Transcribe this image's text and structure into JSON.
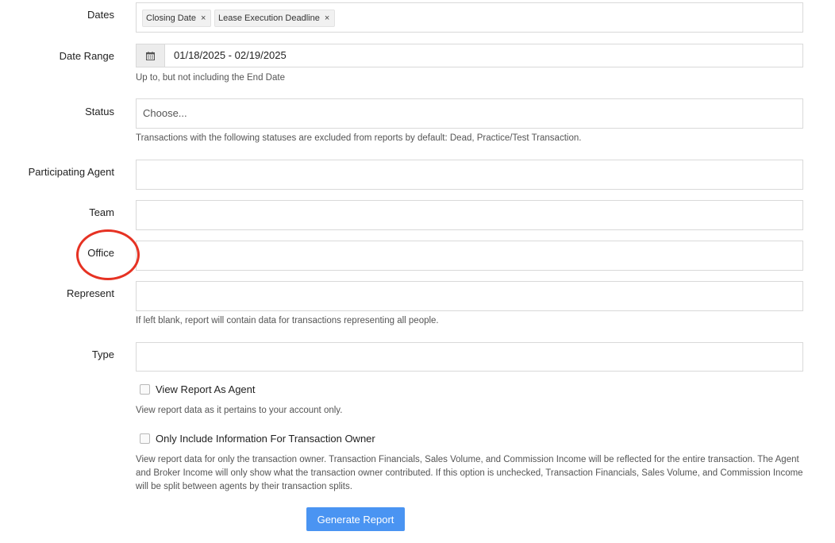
{
  "form": {
    "dates": {
      "label": "Dates",
      "tags": [
        {
          "label": "Closing Date",
          "remove": "×"
        },
        {
          "label": "Lease Execution Deadline",
          "remove": "×"
        }
      ]
    },
    "date_range": {
      "label": "Date Range",
      "value": "01/18/2025 - 02/19/2025",
      "help": "Up to, but not including the End Date"
    },
    "status": {
      "label": "Status",
      "placeholder": "Choose...",
      "help": "Transactions with the following statuses are excluded from reports by default: Dead, Practice/Test Transaction."
    },
    "participating_agent": {
      "label": "Participating Agent"
    },
    "team": {
      "label": "Team"
    },
    "office": {
      "label": "Office"
    },
    "represent": {
      "label": "Represent",
      "help": "If left blank, report will contain data for transactions representing all people."
    },
    "type": {
      "label": "Type"
    },
    "view_as_agent": {
      "label": "View Report As Agent",
      "checked": false,
      "help": "View report data as it pertains to your account only."
    },
    "owner_only": {
      "label": "Only Include Information For Transaction Owner",
      "checked": false,
      "help": "View report data for only the transaction owner. Transaction Financials, Sales Volume, and Commission Income will be reflected for the entire transaction. The Agent and Broker Income will only show what the transaction owner contributed. If this option is unchecked, Transaction Financials, Sales Volume, and Commission Income will be split between agents by their transaction splits."
    },
    "generate_button": "Generate Report"
  },
  "colors": {
    "button": "#4a94f2",
    "annotation_circle": "#e63223",
    "field_border": "#d9d9d9"
  },
  "icons": {
    "date_range": "calendar-icon"
  }
}
